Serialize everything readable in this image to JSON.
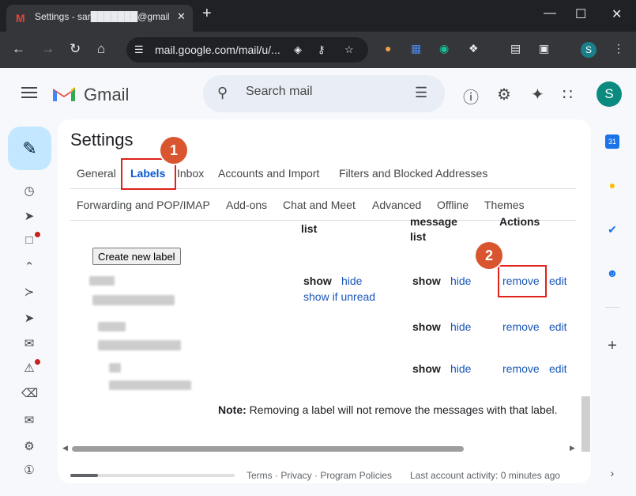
{
  "browser": {
    "tab_title": "Settings - sar███████@gmail.c",
    "tab_close": "✕",
    "new_tab": "+",
    "win_min": "—",
    "win_max": "☐",
    "win_close": "✕",
    "url": "mail.google.com/mail/u/...",
    "profile_initial": "S"
  },
  "gmail": {
    "logo_text": "Gmail",
    "search_placeholder": "Search mail",
    "avatar_initial": "S"
  },
  "settings": {
    "title": "Settings",
    "tabs_row1": [
      "General",
      "Labels",
      "Inbox",
      "Accounts and Import",
      "Filters and Blocked Addresses"
    ],
    "tabs_row2": [
      "Forwarding and POP/IMAP",
      "Add-ons",
      "Chat and Meet",
      "Advanced",
      "Offline",
      "Themes"
    ],
    "active_tab": "Labels",
    "col_list": "list",
    "col_message_list_1": "message",
    "col_message_list_2": "list",
    "col_actions": "Actions",
    "create_label": "Create new label",
    "rows": [
      {
        "show_list": "show",
        "hide_list": "hide",
        "show_if_unread": "show if unread",
        "show_msg": "show",
        "hide_msg": "hide",
        "remove": "remove",
        "edit": "edit"
      },
      {
        "show_msg": "show",
        "hide_msg": "hide",
        "remove": "remove",
        "edit": "edit"
      },
      {
        "show_msg": "show",
        "hide_msg": "hide",
        "remove": "remove",
        "edit": "edit"
      }
    ],
    "note_bold": "Note:",
    "note_text": " Removing a label will not remove the messages with that label.",
    "footer_links": "Terms · Privacy · Program Policies",
    "last_activity": "Last account activity: 0 minutes ago"
  },
  "annotations": {
    "step1": "1",
    "step2": "2"
  },
  "side_panel": {
    "calendar_day": "31"
  },
  "colors": {
    "accent_blue": "#0b57d0",
    "highlight_red": "#e0211c",
    "badge_orange": "#d9552f",
    "compose_bg": "#c2e7ff"
  }
}
